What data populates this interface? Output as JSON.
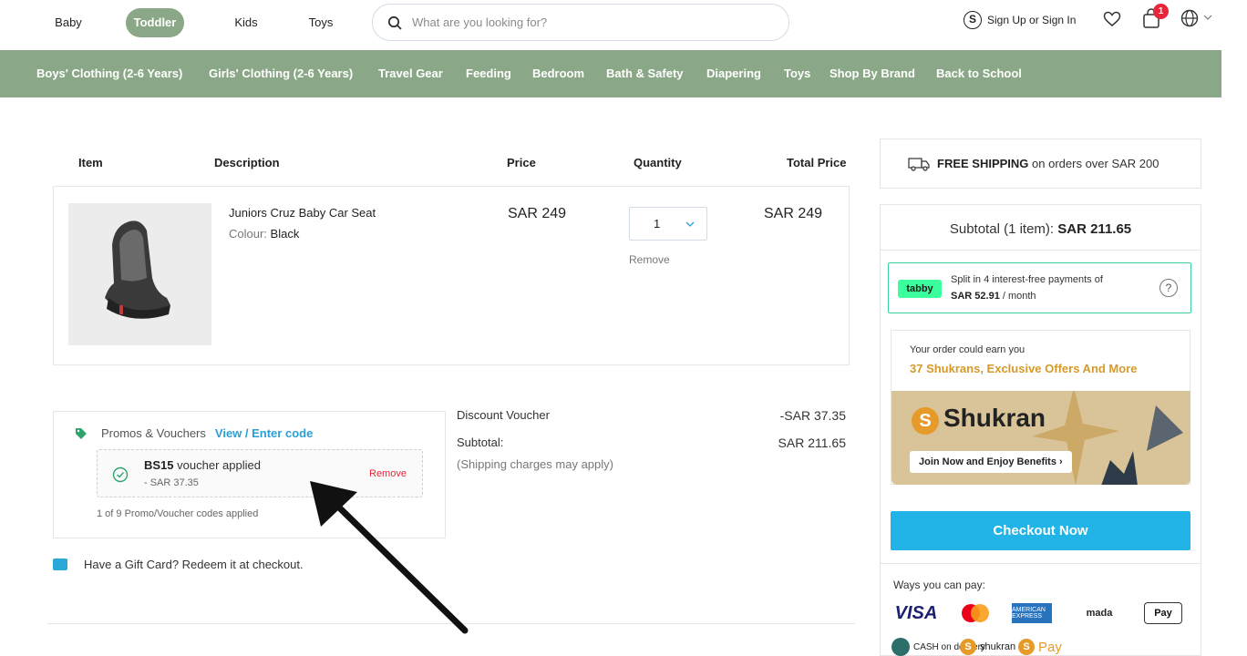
{
  "age_tabs": [
    {
      "label": "Baby",
      "active": false
    },
    {
      "label": "Toddler",
      "active": true
    },
    {
      "label": "Kids",
      "active": false
    },
    {
      "label": "Toys",
      "active": false
    }
  ],
  "search": {
    "placeholder": "What are you looking for?"
  },
  "account": {
    "signin_label": "Sign Up or Sign In",
    "cart_count": "1",
    "s_glyph": "S"
  },
  "nav": [
    "Boys' Clothing (2-6 Years)",
    "Girls' Clothing (2-6 Years)",
    "Travel Gear",
    "Feeding",
    "Bedroom",
    "Bath & Safety",
    "Diapering",
    "Toys",
    "Shop By Brand",
    "Back to School"
  ],
  "cart": {
    "headers": {
      "item": "Item",
      "description": "Description",
      "price": "Price",
      "quantity": "Quantity",
      "total": "Total Price"
    },
    "item": {
      "name": "Juniors Cruz Baby Car Seat",
      "colour_label": "Colour:",
      "colour_value": "Black",
      "price": "SAR 249",
      "quantity": "1",
      "remove": "Remove",
      "total": "SAR 249"
    }
  },
  "promos": {
    "label": "Promos & Vouchers",
    "link": "View / Enter code",
    "voucher_code": "BS15",
    "voucher_text": "voucher applied",
    "voucher_amount": "- SAR 37.35",
    "voucher_remove": "Remove",
    "count_text": "1 of 9 Promo/Voucher codes applied"
  },
  "summary_lines": {
    "discount_label": "Discount Voucher",
    "discount_value": "-SAR 37.35",
    "subtotal_label": "Subtotal:",
    "subtotal_value": "SAR 211.65",
    "shipping_note": "(Shipping charges may apply)"
  },
  "gift": {
    "text": "Have a Gift Card? Redeem it at checkout."
  },
  "sidebar": {
    "free_shipping_bold": "FREE SHIPPING",
    "free_shipping_rest": " on orders over SAR 200",
    "subtotal_label": "Subtotal (1 item):",
    "subtotal_value": "SAR 211.65",
    "tabby_logo": "tabby",
    "tabby_line1": "Split in 4 interest-free payments of",
    "tabby_amount": "SAR 52.91",
    "tabby_per": " / month",
    "tabby_help": "?",
    "shukran_line1": "Your order could earn you",
    "shukran_line2": "37 Shukrans, Exclusive Offers And More",
    "shukran_brand": "Shukran",
    "shukran_s": "S",
    "shukran_join": "Join Now and Enjoy Benefits ›",
    "checkout": "Checkout Now",
    "ways_label": "Ways you can pay:",
    "pay_visa": "VISA",
    "pay_amex": "AMERICAN EXPRESS",
    "pay_mada": "mada",
    "pay_apple": "Pay",
    "pay_cash": "CASH on delivery",
    "pay_shukran": "shukran",
    "pay_spay": "Pay"
  },
  "colors": {
    "nav": "#8aa887",
    "accent": "#22b4e6",
    "link": "#2a9fd6",
    "badge": "#e8253a",
    "shukran": "#d69a2a"
  }
}
